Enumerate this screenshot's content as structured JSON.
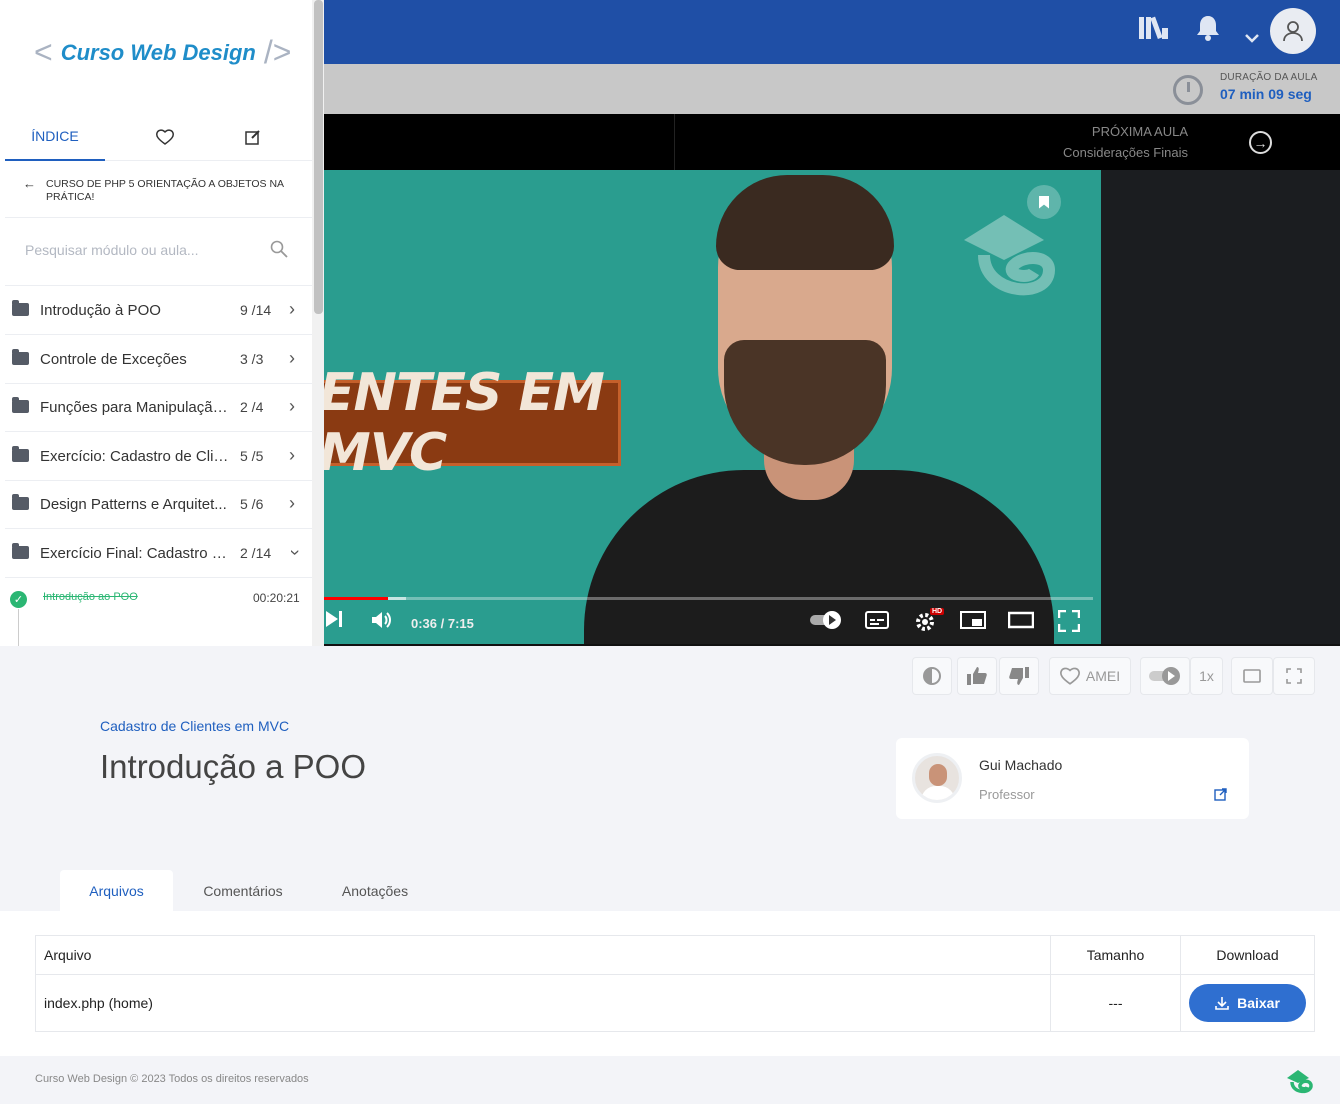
{
  "header": {
    "duration_label": "DURAÇÃO DA AULA",
    "duration_value": "07 min 09 seg"
  },
  "next_lesson": {
    "label": "PRÓXIMA AULA",
    "title": "Considerações Finais"
  },
  "sidebar": {
    "brand": "Curso Web Design",
    "tabs": {
      "index": "ÍNDICE"
    },
    "course_title": "CURSO DE PHP 5 ORIENTAÇÃO A OBJETOS NA PRÁTICA!",
    "search_placeholder": "Pesquisar módulo ou aula...",
    "modules": [
      {
        "title": "Introdução à POO",
        "count": "9 /14"
      },
      {
        "title": "Controle de Exceções",
        "count": "3 /3"
      },
      {
        "title": "Funções para Manipulação...",
        "count": "2 /4"
      },
      {
        "title": "Exercício: Cadastro de Clie...",
        "count": "5 /5"
      },
      {
        "title": "Design Patterns e Arquitet...",
        "count": "5 /6"
      },
      {
        "title": "Exercício Final: Cadastro d...",
        "count": "2 /14"
      }
    ],
    "lesson": {
      "title": "Introdução ao POO",
      "time": "00:20:21"
    }
  },
  "video": {
    "banner_text": "ENTES EM MVC",
    "time": "0:36 / 7:15",
    "played_fraction": 0.083,
    "hd_badge": "HD"
  },
  "toolbar": {
    "love_label": "AMEI",
    "speed_label": "1x"
  },
  "lesson": {
    "breadcrumb": "Cadastro de Clientes em MVC",
    "title": "Introdução a POO"
  },
  "teacher": {
    "name": "Gui Machado",
    "role": "Professor"
  },
  "content_tabs": [
    "Arquivos",
    "Comentários",
    "Anotações"
  ],
  "files_table": {
    "headers": [
      "Arquivo",
      "Tamanho",
      "Download"
    ],
    "rows": [
      {
        "file": "index.php (home)",
        "size": "---",
        "action": "Baixar"
      }
    ]
  },
  "footer": {
    "copyright": "Curso Web Design © 2023 Todos os direitos reservados"
  },
  "colors": {
    "brand_blue": "#1f4fa6",
    "accent": "#1f5fbf",
    "success": "#2bb673",
    "video_bg": "#2a9d8f"
  }
}
